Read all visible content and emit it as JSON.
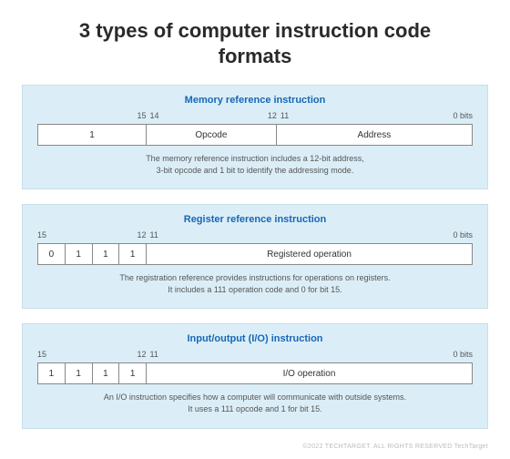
{
  "title": "3 types of computer instruction code formats",
  "panels": [
    {
      "title": "Memory reference instruction",
      "bits": {
        "b15": "15",
        "b14": "14",
        "b12": "12",
        "b11": "11",
        "b0": "0 bits"
      },
      "cells": {
        "c0": "1",
        "c1": "Opcode",
        "c2": "Address"
      },
      "desc1": "The memory reference instruction includes a 12-bit address,",
      "desc2": "3-bit opcode and 1 bit to identify the addressing mode."
    },
    {
      "title": "Register reference instruction",
      "bits": {
        "b15": "15",
        "b12": "12",
        "b11": "11",
        "b0": "0 bits"
      },
      "cells": {
        "c0": "0",
        "c1": "1",
        "c2": "1",
        "c3": "1",
        "c4": "Registered operation"
      },
      "desc1": "The registration reference provides instructions for operations on registers.",
      "desc2": "It includes a 111 operation code and 0 for bit 15."
    },
    {
      "title": "Input/output (I/O) instruction",
      "bits": {
        "b15": "15",
        "b12": "12",
        "b11": "11",
        "b0": "0 bits"
      },
      "cells": {
        "c0": "1",
        "c1": "1",
        "c2": "1",
        "c3": "1",
        "c4": "I/O operation"
      },
      "desc1": "An I/O instruction specifies how a computer will communicate with outside systems.",
      "desc2": "It uses a 111 opcode and 1 for bit 15."
    }
  ],
  "footer": "©2022 TECHTARGET. ALL RIGHTS RESERVED    TechTarget"
}
